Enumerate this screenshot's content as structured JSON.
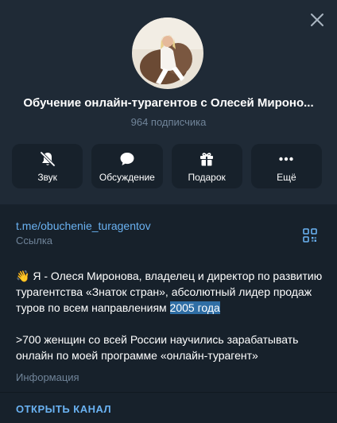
{
  "channel": {
    "title": "Обучение онлайн-турагентов с Олесей Мироно...",
    "subscribers": "964 подписчика"
  },
  "actions": [
    {
      "label": "Звук",
      "icon": "mute-bell-icon"
    },
    {
      "label": "Обсуждение",
      "icon": "chat-bubble-icon"
    },
    {
      "label": "Подарок",
      "icon": "gift-icon"
    },
    {
      "label": "Ещё",
      "icon": "more-dots-icon"
    }
  ],
  "link": {
    "url": "t.me/obuchenie_turagentov",
    "caption": "Ссылка"
  },
  "description": {
    "p1_emoji": "👋",
    "p1_text": " Я - Олеся Миронова, владелец и директор по развитию турагентства «Знаток стран», абсолютный лидер продаж туров по всем направлениям ",
    "p1_highlight": "2005 года",
    "p2_text": ">700 женщин со всей России научились зарабатывать онлайн по моей программе «онлайн-турагент»",
    "caption": "Информация"
  },
  "open_button": "ОТКРЫТЬ КАНАЛ",
  "colors": {
    "background": "#17212b",
    "header": "#1f2a36",
    "accent": "#6ab2f2",
    "muted": "#708499",
    "highlight": "#2f6ea5"
  }
}
